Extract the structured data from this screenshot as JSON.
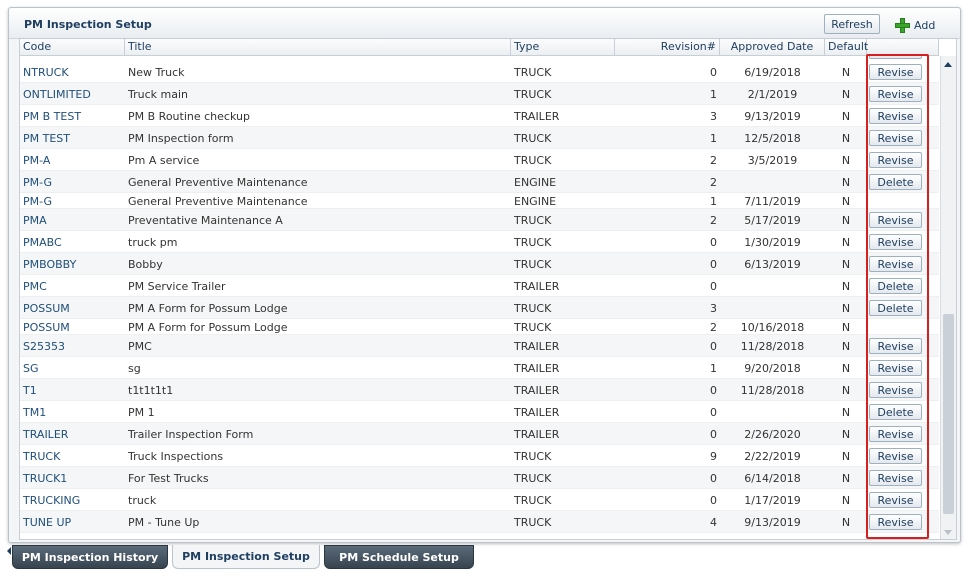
{
  "panel": {
    "title": "PM Inspection Setup",
    "refresh_label": "Refresh",
    "add_label": "Add"
  },
  "table": {
    "columns": {
      "code": "Code",
      "title": "Title",
      "type": "Type",
      "revision": "Revision#",
      "approved_date": "Approved Date",
      "default": "Default"
    },
    "rows": [
      {
        "code": "NTRUCK",
        "title": "New Truck",
        "type": "TRUCK",
        "revision": "0",
        "approved": "6/19/2018",
        "default": "N",
        "action": "Revise"
      },
      {
        "code": "ONTLIMITED",
        "title": "Truck main",
        "type": "TRUCK",
        "revision": "1",
        "approved": "2/1/2019",
        "default": "N",
        "action": "Revise"
      },
      {
        "code": "PM B TEST",
        "title": "PM B Routine checkup",
        "type": "TRAILER",
        "revision": "3",
        "approved": "9/13/2019",
        "default": "N",
        "action": "Revise"
      },
      {
        "code": "PM TEST",
        "title": "PM Inspection form",
        "type": "TRUCK",
        "revision": "1",
        "approved": "12/5/2018",
        "default": "N",
        "action": "Revise"
      },
      {
        "code": "PM-A",
        "title": "Pm A service",
        "type": "TRUCK",
        "revision": "2",
        "approved": "3/5/2019",
        "default": "N",
        "action": "Revise"
      },
      {
        "code": "PM-G",
        "title": "General Preventive Maintenance",
        "type": "ENGINE",
        "revision": "2",
        "approved": "",
        "default": "N",
        "action": "Delete"
      },
      {
        "code": "PM-G",
        "title": "General Preventive Maintenance",
        "type": "ENGINE",
        "revision": "1",
        "approved": "7/11/2019",
        "default": "N",
        "action": ""
      },
      {
        "code": "PMA",
        "title": "Preventative Maintenance A",
        "type": "TRUCK",
        "revision": "2",
        "approved": "5/17/2019",
        "default": "N",
        "action": "Revise"
      },
      {
        "code": "PMABC",
        "title": "truck pm",
        "type": "TRUCK",
        "revision": "0",
        "approved": "1/30/2019",
        "default": "N",
        "action": "Revise"
      },
      {
        "code": "PMBOBBY",
        "title": "Bobby",
        "type": "TRUCK",
        "revision": "0",
        "approved": "6/13/2019",
        "default": "N",
        "action": "Revise"
      },
      {
        "code": "PMC",
        "title": "PM Service Trailer",
        "type": "TRAILER",
        "revision": "0",
        "approved": "",
        "default": "N",
        "action": "Delete"
      },
      {
        "code": "POSSUM",
        "title": "PM A Form for Possum Lodge",
        "type": "TRUCK",
        "revision": "3",
        "approved": "",
        "default": "N",
        "action": "Delete"
      },
      {
        "code": "POSSUM",
        "title": "PM A Form for Possum Lodge",
        "type": "TRUCK",
        "revision": "2",
        "approved": "10/16/2018",
        "default": "N",
        "action": ""
      },
      {
        "code": "S25353",
        "title": "PMC",
        "type": "TRAILER",
        "revision": "0",
        "approved": "11/28/2018",
        "default": "N",
        "action": "Revise"
      },
      {
        "code": "SG",
        "title": "sg",
        "type": "TRAILER",
        "revision": "1",
        "approved": "9/20/2018",
        "default": "N",
        "action": "Revise"
      },
      {
        "code": "T1",
        "title": "t1t1t1t1",
        "type": "TRAILER",
        "revision": "0",
        "approved": "11/28/2018",
        "default": "N",
        "action": "Revise"
      },
      {
        "code": "TM1",
        "title": "PM 1",
        "type": "TRAILER",
        "revision": "0",
        "approved": "",
        "default": "N",
        "action": "Delete"
      },
      {
        "code": "TRAILER",
        "title": "Trailer Inspection Form",
        "type": "TRAILER",
        "revision": "0",
        "approved": "2/26/2020",
        "default": "N",
        "action": "Revise"
      },
      {
        "code": "TRUCK",
        "title": "Truck Inspections",
        "type": "TRUCK",
        "revision": "9",
        "approved": "2/22/2019",
        "default": "N",
        "action": "Revise"
      },
      {
        "code": "TRUCK1",
        "title": "For Test Trucks",
        "type": "TRUCK",
        "revision": "0",
        "approved": "6/14/2018",
        "default": "N",
        "action": "Revise"
      },
      {
        "code": "TRUCKING",
        "title": "truck",
        "type": "TRUCK",
        "revision": "0",
        "approved": "1/17/2019",
        "default": "N",
        "action": "Revise"
      },
      {
        "code": "TUNE UP",
        "title": "PM - Tune Up",
        "type": "TRUCK",
        "revision": "4",
        "approved": "9/13/2019",
        "default": "N",
        "action": "Revise"
      }
    ]
  },
  "tabs": [
    {
      "label": "PM Inspection History",
      "active": false
    },
    {
      "label": "PM Inspection Setup",
      "active": true
    },
    {
      "label": "PM Schedule Setup",
      "active": false
    }
  ],
  "colors": {
    "accent_highlight": "#d61f1f",
    "link_text": "#1f4e79",
    "add_icon": "#3aa52a"
  }
}
